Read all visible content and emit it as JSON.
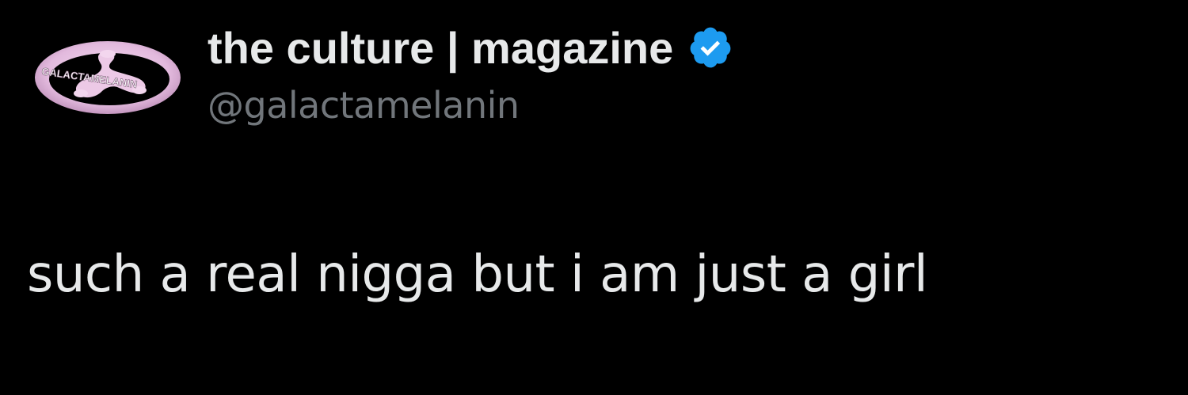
{
  "tweet": {
    "author": {
      "display_name": "the culture | magazine",
      "handle": "@galactamelanin",
      "avatar_icon": "galactamelanin-logo-icon",
      "avatar_logo_text": "GALACTAMELANIN",
      "verified_icon": "verified-badge-icon",
      "verified_color": "#1d9bf0"
    },
    "text": "such a real nigga but i am just a girl"
  },
  "colors": {
    "background": "#000000",
    "primary_text": "#e7e9ea",
    "secondary_text": "#71767b",
    "logo_pink": "#e6bfe0"
  }
}
